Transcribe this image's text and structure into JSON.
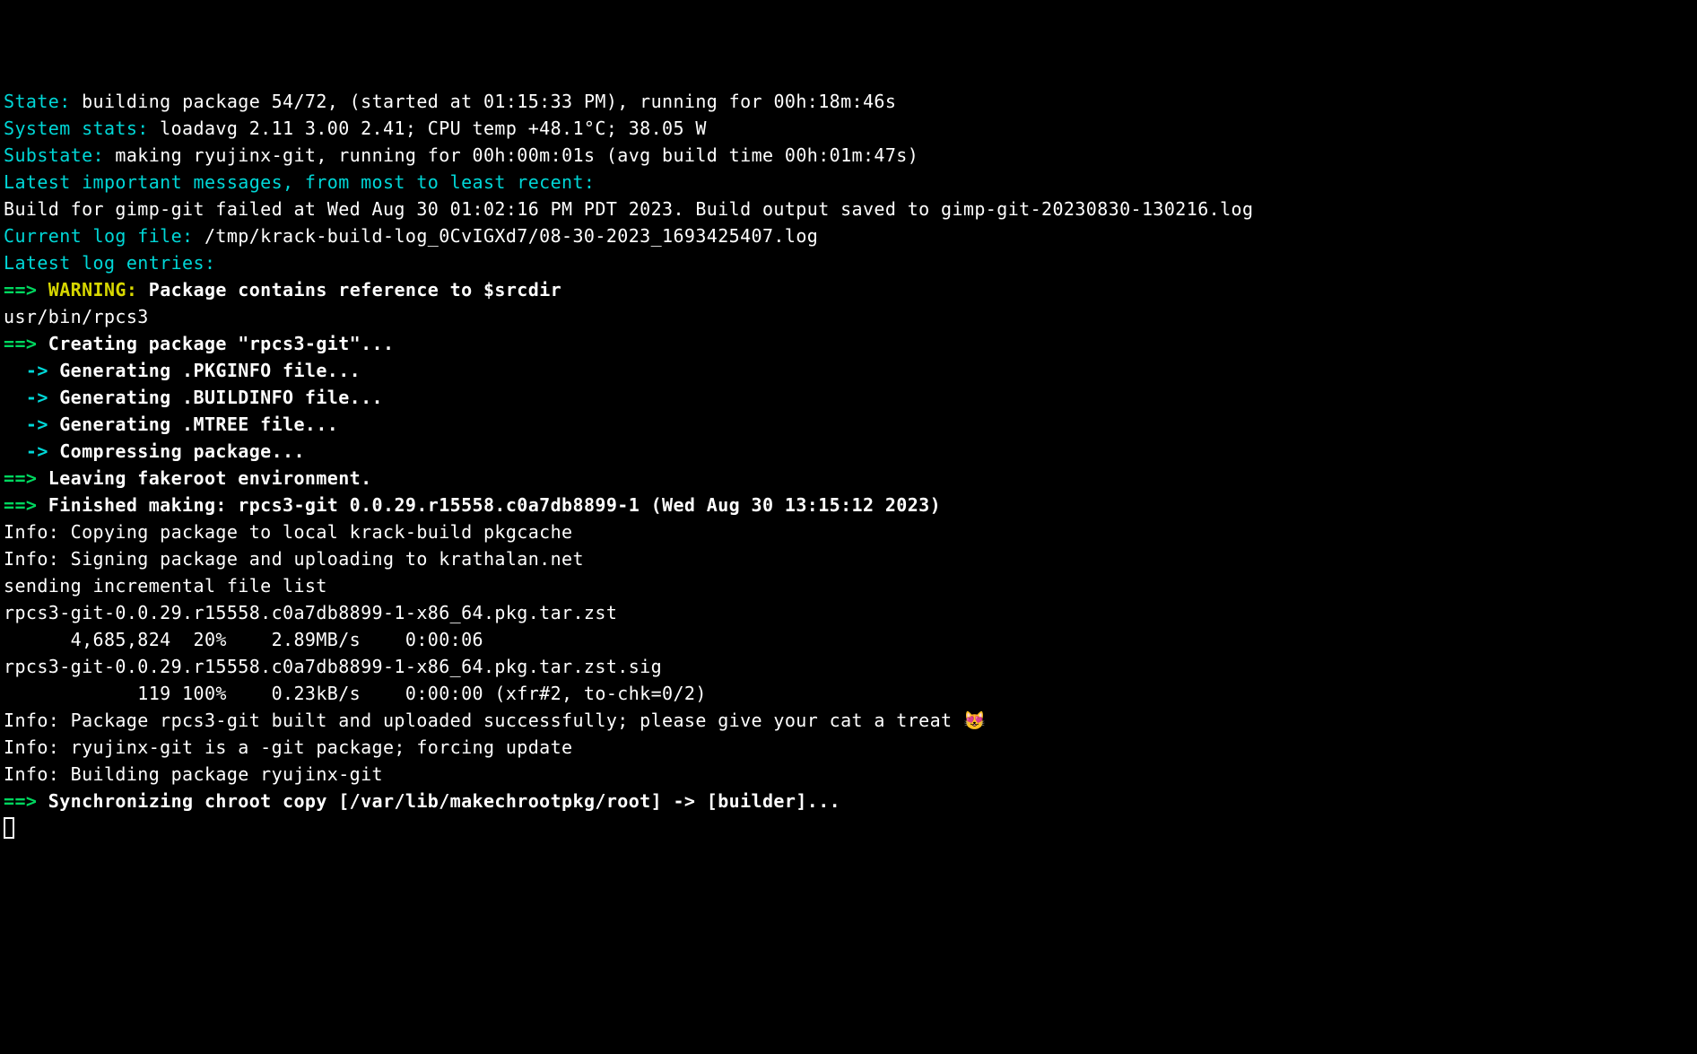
{
  "labels": {
    "state": "State:",
    "system_stats": "System stats:",
    "substate": "Substate:",
    "latest_important": "Latest important messages, from most to least recent:",
    "current_log_file": "Current log file:",
    "latest_log_entries": "Latest log entries:"
  },
  "state_value": " building package 54/72, (started at 01:15:33 PM), running for 00h:18m:46s",
  "system_stats_value": " loadavg 2.11 3.00 2.41; CPU temp +48.1°C; 38.05 W",
  "substate_value": " making ryujinx-git, running for 00h:00m:01s (avg build time 00h:01m:47s)",
  "fail_line": "Build for gimp-git failed at Wed Aug 30 01:02:16 PM PDT 2023. Build output saved to gimp-git-20230830-130216.log",
  "log_file_value": " /tmp/krack-build-log_0CvIGXd7/08-30-2023_1693425407.log",
  "entries": {
    "arrow": "==>",
    "sub_arrow": "  ->",
    "warning_label": " WARNING:",
    "warning_text": " Package contains reference to $srcdir",
    "srcdir_file": "usr/bin/rpcs3",
    "creating_pkg": " Creating package \"rpcs3-git\"...",
    "gen_pkginfo": " Generating .PKGINFO file...",
    "gen_buildinfo": " Generating .BUILDINFO file...",
    "gen_mtree": " Generating .MTREE file...",
    "compressing": " Compressing package...",
    "leaving_fakeroot": " Leaving fakeroot environment.",
    "finished_making": " Finished making: rpcs3-git 0.0.29.r15558.c0a7db8899-1 (Wed Aug 30 13:15:12 2023)",
    "info_copying": "Info: Copying package to local krack-build pkgcache",
    "info_signing": "Info: Signing package and uploading to krathalan.net",
    "sending_list": "sending incremental file list",
    "file1": "rpcs3-git-0.0.29.r15558.c0a7db8899-1-x86_64.pkg.tar.zst",
    "file1_stats": "      4,685,824  20%    2.89MB/s    0:00:06",
    "file2": "rpcs3-git-0.0.29.r15558.c0a7db8899-1-x86_64.pkg.tar.zst.sig",
    "file2_stats": "            119 100%    0.23kB/s    0:00:00 (xfr#2, to-chk=0/2)",
    "info_built": "Info: Package rpcs3-git built and uploaded successfully; please give your cat a treat ",
    "cat_emoji": "😻",
    "info_ryujinx_git": "Info: ryujinx-git is a -git package; forcing update",
    "info_building": "Info: Building package ryujinx-git",
    "sync_chroot": " Synchronizing chroot copy [/var/lib/makechrootpkg/root] -> [builder]..."
  }
}
